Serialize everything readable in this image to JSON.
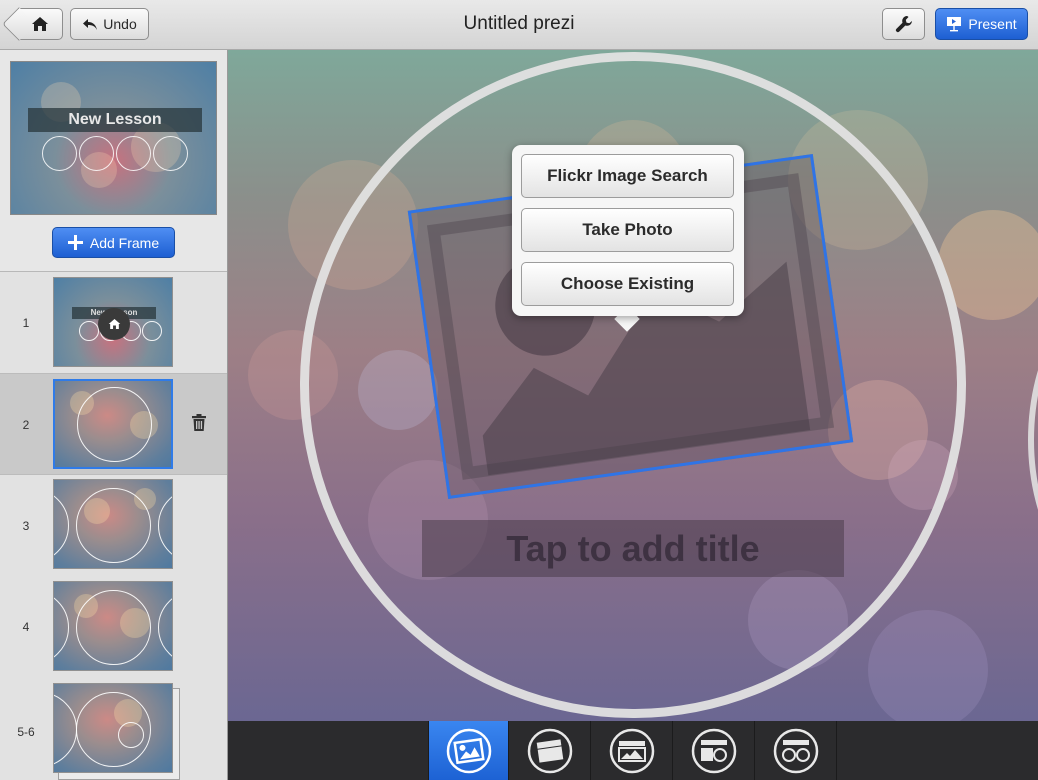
{
  "header": {
    "title": "Untitled prezi",
    "undo_label": "Undo",
    "present_label": "Present",
    "icons": {
      "home": "home-icon",
      "undo": "undo-arrow-icon",
      "tools": "wrench-icon",
      "present": "projector-icon"
    }
  },
  "sidebar": {
    "overview_title": "New Lesson",
    "add_frame_label": "Add Frame",
    "frames": [
      {
        "number": "1",
        "label": "New Lesson"
      },
      {
        "number": "2",
        "selected": true
      },
      {
        "number": "3"
      },
      {
        "number": "4"
      },
      {
        "number": "5-6"
      }
    ]
  },
  "canvas": {
    "title_placeholder": "Tap to add title"
  },
  "popover": {
    "options": [
      "Flickr Image Search",
      "Take Photo",
      "Choose Existing"
    ]
  },
  "toolbar": {
    "layouts": [
      "image-layout-icon",
      "frame-layout-icon",
      "images-layout-icon",
      "frame-circle-layout-icon",
      "two-circles-layout-icon"
    ],
    "active_index": 0
  },
  "colors": {
    "accent": "#2f74e6",
    "toolbar_bg": "#2b2b2d"
  }
}
